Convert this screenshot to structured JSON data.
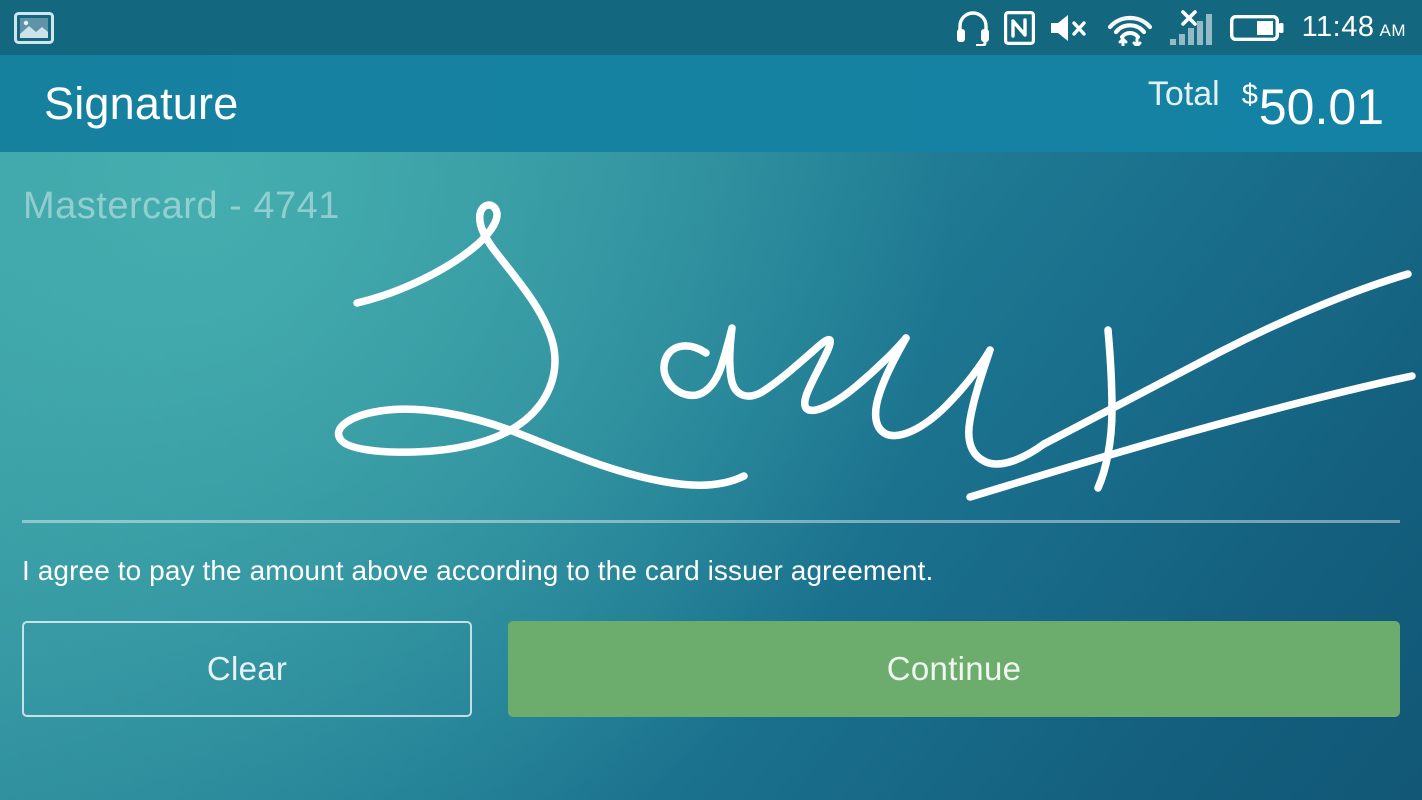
{
  "status_bar": {
    "left_icons": [
      {
        "name": "screenshot-icon",
        "label": "screenshot"
      }
    ],
    "right_icons": [
      {
        "name": "headset-icon",
        "label": "headset"
      },
      {
        "name": "nfc-icon",
        "label": "NFC"
      },
      {
        "name": "volume-mute-icon",
        "label": "volume muted"
      },
      {
        "name": "wifi-icon",
        "label": "wifi data"
      },
      {
        "name": "cellular-signal-off-icon",
        "label": "no cellular signal"
      },
      {
        "name": "battery-icon",
        "label": "battery"
      }
    ],
    "time": "11:48",
    "meridiem": "AM"
  },
  "header": {
    "title": "Signature",
    "total_label": "Total",
    "currency_symbol": "$",
    "total_amount": "50.01"
  },
  "main": {
    "card_label": "Mastercard  -  4741",
    "signature_present": true,
    "agreement_text": "I agree to pay the amount above according to the card issuer agreement."
  },
  "buttons": {
    "clear_label": "Clear",
    "continue_label": "Continue"
  },
  "colors": {
    "status_bar": "#13677e",
    "app_bar": "#1680a0",
    "body_start": "#3a9ea6",
    "body_end": "#125776",
    "continue_green": "#6cad6d",
    "signature_stroke": "#ffffff"
  }
}
